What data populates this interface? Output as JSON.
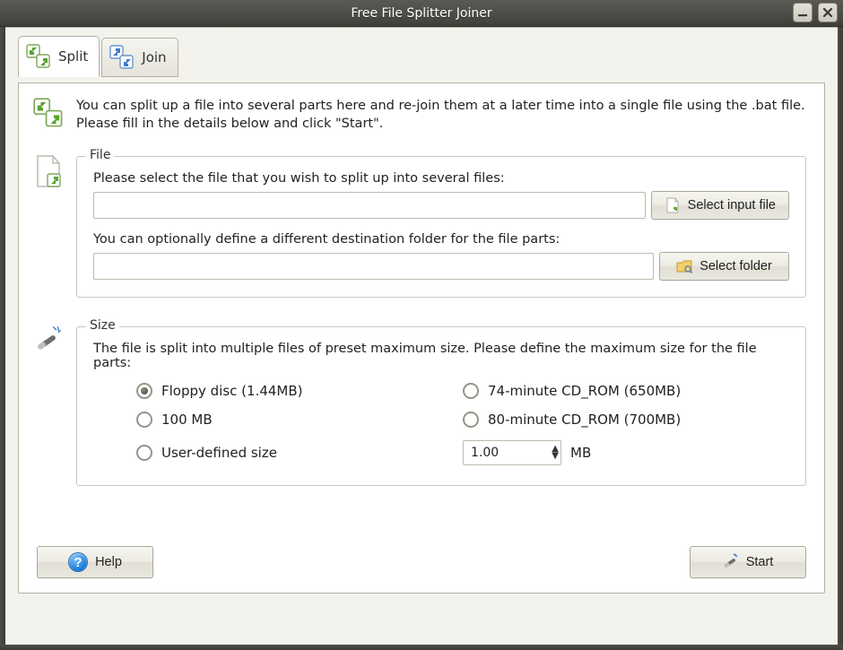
{
  "window": {
    "title": "Free File Splitter Joiner"
  },
  "tabs": {
    "split": "Split",
    "join": "Join"
  },
  "intro": "You can split up a file into several parts here and re-join them at a later time into a single file using the .bat file. Please fill in the details below and click \"Start\".",
  "fileGroup": {
    "legend": "File",
    "selectFilePrompt": "Please select the file that you wish to split up into several files:",
    "inputFileValue": "",
    "selectInputBtn": "Select input file",
    "destPrompt": "You can optionally define a different destination folder for the file parts:",
    "destValue": "",
    "selectFolderBtn": "Select folder"
  },
  "sizeGroup": {
    "legend": "Size",
    "prompt": "The file is split into multiple files of preset maximum size. Please define the maximum size for the file parts:",
    "options": {
      "floppy": "Floppy disc (1.44MB)",
      "cd74": "74-minute CD_ROM (650MB)",
      "mb100": "100 MB",
      "cd80": "80-minute CD_ROM (700MB)",
      "user": "User-defined size"
    },
    "customValue": "1.00",
    "unit": "MB"
  },
  "footer": {
    "help": "Help",
    "start": "Start"
  }
}
